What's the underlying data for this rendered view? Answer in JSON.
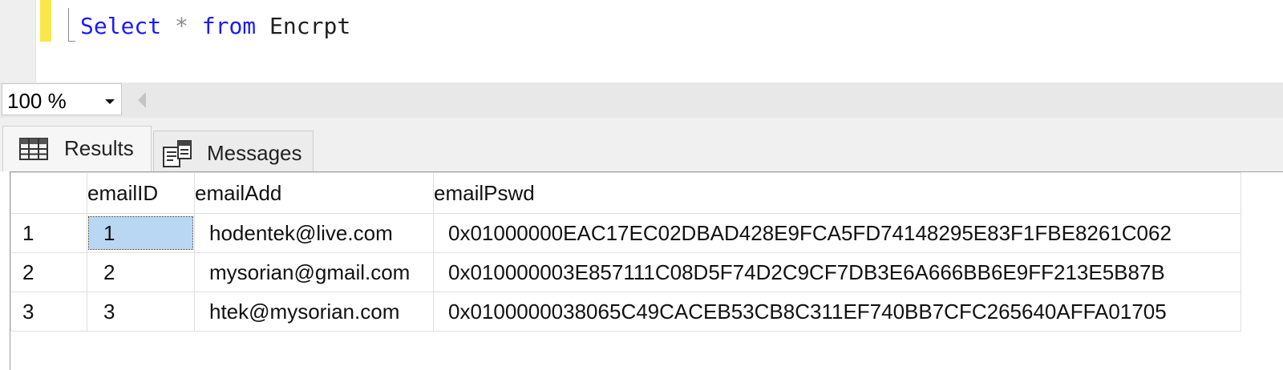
{
  "editor": {
    "query": {
      "keyword_select": "Select",
      "operator": "*",
      "keyword_from": "from",
      "table": "Encrpt"
    }
  },
  "zoom": {
    "value": "100 %"
  },
  "tabs": [
    {
      "label": "Results",
      "icon": "grid-icon",
      "active": true
    },
    {
      "label": "Messages",
      "icon": "messages-icon",
      "active": false
    }
  ],
  "grid": {
    "columns": [
      "emailID",
      "emailAdd",
      "emailPswd"
    ],
    "rows": [
      {
        "num": "1",
        "emailID": "1",
        "emailAdd": "hodentek@live.com",
        "emailPswd": "0x01000000EAC17EC02DBAD428E9FCA5FD74148295E83F1FBE8261C062"
      },
      {
        "num": "2",
        "emailID": "2",
        "emailAdd": "mysorian@gmail.com",
        "emailPswd": "0x010000003E857111C08D5F74D2C9CF7DB3E6A666BB6E9FF213E5B87B"
      },
      {
        "num": "3",
        "emailID": "3",
        "emailAdd": "htek@mysorian.com",
        "emailPswd": "0x0100000038065C49CACEB53CB8C311EF740BB7CFC265640AFFA01705"
      }
    ],
    "selected_cell_color": "#b9d6f2"
  }
}
